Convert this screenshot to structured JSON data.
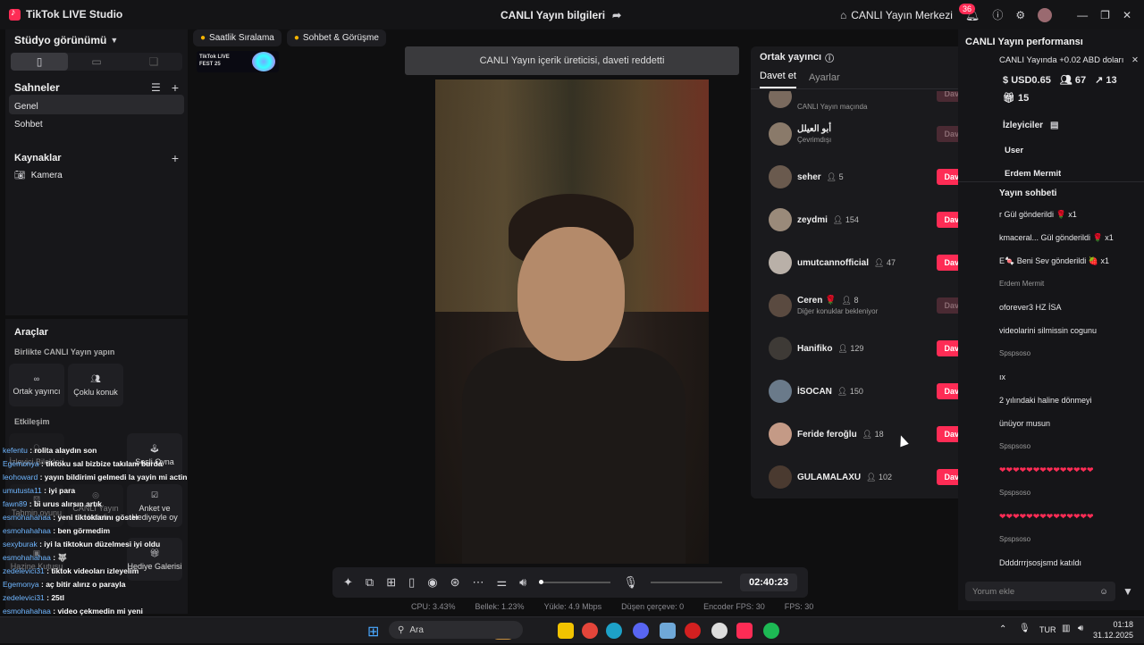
{
  "app": {
    "title": "TikTok LIVE Studio",
    "center_title": "CANLI Yayın bilgileri",
    "live_center": "CANLI Yayın Merkezi",
    "notif_count": "36"
  },
  "left": {
    "studio_view": "Stüdyo görünümü",
    "scenes_title": "Sahneler",
    "scenes": [
      "Genel",
      "Sohbet"
    ],
    "sources_title": "Kaynaklar",
    "sources": [
      "Kamera"
    ]
  },
  "tools": {
    "title": "Araçlar",
    "together_title": "Birlikte CANLI Yayın yapın",
    "together": [
      "Ortak yayıncı",
      "Çoklu konuk"
    ],
    "engage_title": "Etkileşim",
    "engage": [
      "İzleyici Bilekleri",
      "Sesli Oyna",
      "Tahmin oyunu",
      "CANLI Yayın Hedefi",
      "Anket ve Hediyeyle oy",
      "Hazine Kutusu",
      "Hediye Galerisi"
    ]
  },
  "chips": [
    "Saatlik Sıralama",
    "Sohbet & Görüşme"
  ],
  "fest_logo": "TikTok LIVE FEST 25",
  "toast": "CANLI Yayın içerik üreticisi, daveti reddetti",
  "controls": {
    "timer": "02:40:23"
  },
  "stats": [
    "CPU: 3.43%",
    "Bellek: 1.23%",
    "Yükle: 4.9 Mbps",
    "Düşen çerçeve: 0",
    "Encoder FPS: 30",
    "FPS: 30"
  ],
  "cohost": {
    "title": "Ortak yayıncı",
    "tabs": [
      "Davet et",
      "Ayarlar"
    ],
    "top_partial_sub": "CANLI Yayın maçında",
    "invite_label": "Davet et",
    "users": [
      {
        "name": "أبو العيلل",
        "count": "",
        "sub": "Çevrimdışı",
        "enabled": false
      },
      {
        "name": "seher",
        "count": "5",
        "sub": "",
        "enabled": true
      },
      {
        "name": "zeydmi",
        "count": "154",
        "sub": "",
        "enabled": true
      },
      {
        "name": "umutcannofficial",
        "count": "47",
        "sub": "",
        "enabled": true
      },
      {
        "name": "Ceren 🌹",
        "count": "8",
        "sub": "Diğer konuklar bekleniyor",
        "enabled": false
      },
      {
        "name": "Hanifiko",
        "count": "129",
        "sub": "",
        "enabled": true
      },
      {
        "name": "İSOCAN",
        "count": "150",
        "sub": "",
        "enabled": true
      },
      {
        "name": "Feride feroğlu",
        "count": "18",
        "sub": "",
        "enabled": true
      },
      {
        "name": "GULAMALAXU",
        "count": "102",
        "sub": "",
        "enabled": true
      }
    ]
  },
  "perf": {
    "title": "CANLI Yayın performansı",
    "banner": "CANLI Yayında +0.02 ABD doları",
    "usd": "USD0.65",
    "viewers": "67",
    "likes": "13",
    "gifts": "15",
    "viewers_tab": "İzleyiciler",
    "viewer_rows": [
      "User",
      "Erdem Mermit"
    ],
    "chat_title": "Yayın sohbeti",
    "chat": [
      "r Gül gönderildi 🌹 x1",
      "kmaceral... Gül gönderildi 🌹 x1",
      "E🍬 Beni Sev gönderildi 🍓 x1",
      "Erdem Mermit",
      "oforever3 HZ İSA",
      "videolarini silmissin cogunu",
      "Spspsoso",
      "ıx",
      "2 yılındaki haline dönmeyi",
      "ünüyor musun",
      "Spspsoso",
      "❤❤❤❤❤❤❤❤❤❤❤❤❤❤",
      "Spspsoso",
      "❤❤❤❤❤❤❤❤❤❤❤❤❤❤",
      "Spspsoso",
      "Ddddrrrjsosjsmd katıldı"
    ],
    "comment_placeholder": "Yorum ekle"
  },
  "overlay_chat": [
    {
      "u": "kefentu",
      "t": "rolita alaydın son"
    },
    {
      "u": "Egemonya",
      "t": "tiktoku sal bizbize takılam burda"
    },
    {
      "u": "leohoward",
      "t": "yayın bildirimi gelmedi la yayin mi actin"
    },
    {
      "u": "umutusta11",
      "t": "iyi para"
    },
    {
      "u": "fawn89",
      "t": "bi urus alırsın artık"
    },
    {
      "u": "esmohahahaa",
      "t": "yeni tiktoklarını göster"
    },
    {
      "u": "esmohahahaa",
      "t": "ben görmedim"
    },
    {
      "u": "sexyburak",
      "t": "iyi la tiktokun düzelmesi iyi oldu"
    },
    {
      "u": "esmohahahaa",
      "t": "🐺"
    },
    {
      "u": "zedelevici31",
      "t": "tiktok videoları izleyelim"
    },
    {
      "u": "Egemonya",
      "t": "aç bitir alırız o parayla"
    },
    {
      "u": "zedelevici31",
      "t": "25tl"
    },
    {
      "u": "esmohahahaa",
      "t": "video çekmedin mi yeni"
    },
    {
      "u": "samsunpe",
      "t": "2.7 TL"
    },
    {
      "u": "esmohahahaa",
      "t": "oğlum"
    }
  ],
  "taskbar": {
    "search": "Ara",
    "lang": "TUR",
    "time": "01:18",
    "date": "31.12.2025"
  },
  "colors": {
    "accent": "#fe2c55"
  }
}
